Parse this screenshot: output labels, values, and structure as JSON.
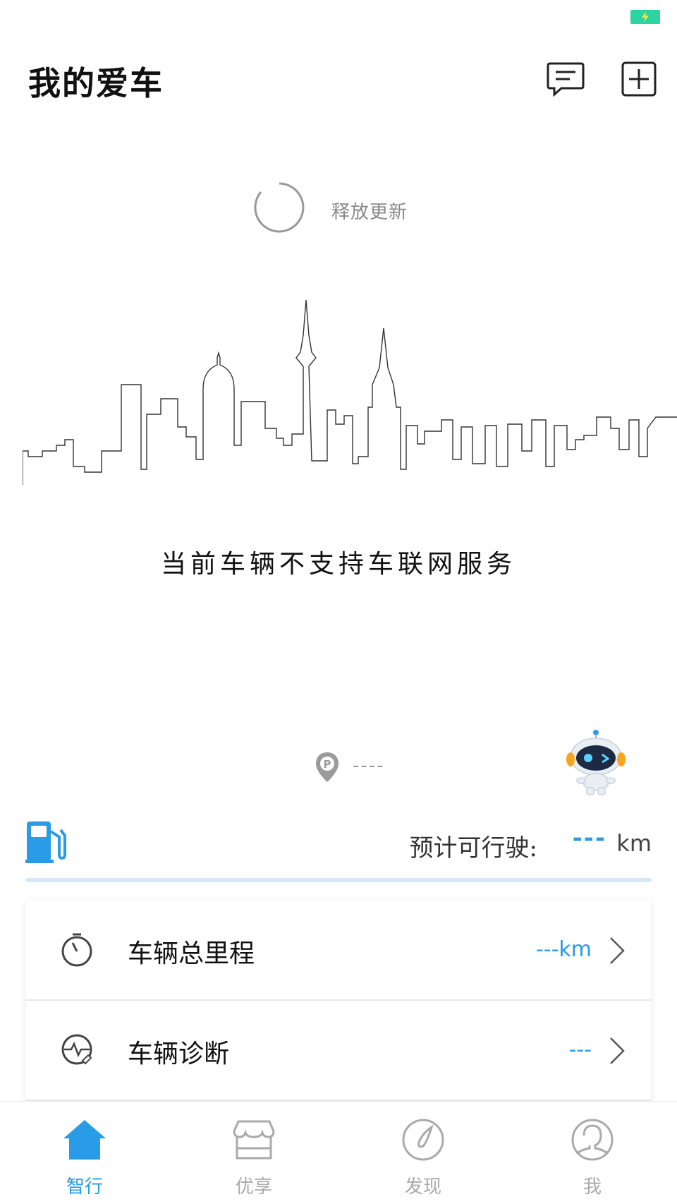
{
  "header": {
    "title": "我的爱车",
    "message_icon": "message-icon",
    "add_icon": "add-icon"
  },
  "refresh": {
    "text": "释放更新"
  },
  "notice": {
    "text": "当前车辆不支持车联网服务"
  },
  "location": {
    "icon": "parking-pin-icon",
    "text": "----"
  },
  "fuel": {
    "icon": "fuel-pump-icon",
    "range_label": "预计可行驶:",
    "range_value": "---",
    "range_unit": "km",
    "level_fraction": 0
  },
  "vehicle_list": [
    {
      "icon": "odometer-icon",
      "label": "车辆总里程",
      "value": "---km"
    },
    {
      "icon": "diagnosis-icon",
      "label": "车辆诊断",
      "value": "---"
    }
  ],
  "tabbar": {
    "tabs": [
      {
        "label": "智行",
        "icon": "home-icon",
        "active": true
      },
      {
        "label": "优享",
        "icon": "store-icon",
        "active": false
      },
      {
        "label": "发现",
        "icon": "compass-icon",
        "active": false
      },
      {
        "label": "我",
        "icon": "profile-icon",
        "active": false
      }
    ]
  },
  "colors": {
    "accent": "#2a9be6",
    "battery": "#2ed3a2",
    "inactive": "#aaaaaa"
  }
}
